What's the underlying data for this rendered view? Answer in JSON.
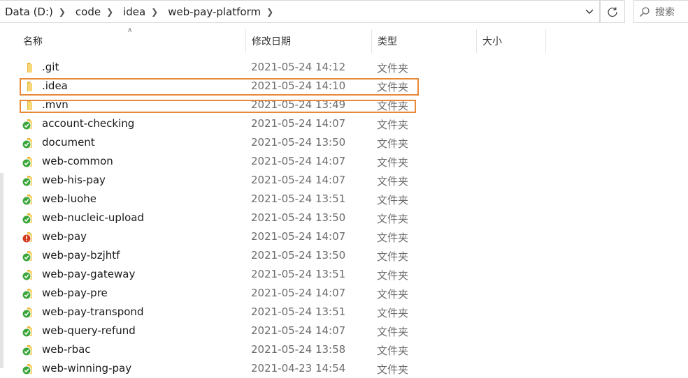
{
  "address_bar": {
    "crumbs": [
      "Data (D:)",
      "code",
      "idea",
      "web-pay-platform"
    ]
  },
  "search": {
    "placeholder": "搜索"
  },
  "columns": {
    "name": "名称",
    "date": "修改日期",
    "type": "类型",
    "size": "大小"
  },
  "files": [
    {
      "name": ".git",
      "date": "2021-05-24 14:12",
      "type": "文件夹",
      "icon": "folder-icon"
    },
    {
      "name": ".idea",
      "date": "2021-05-24 14:10",
      "type": "文件夹",
      "icon": "folder-icon",
      "highlighted": true
    },
    {
      "name": ".mvn",
      "date": "2021-05-24 13:49",
      "type": "文件夹",
      "icon": "folder-icon",
      "highlighted": true
    },
    {
      "name": "account-checking",
      "date": "2021-05-24 14:07",
      "type": "文件夹",
      "icon": "svn-ok-folder-icon"
    },
    {
      "name": "document",
      "date": "2021-05-24 13:50",
      "type": "文件夹",
      "icon": "svn-ok-folder-icon"
    },
    {
      "name": "web-common",
      "date": "2021-05-24 14:07",
      "type": "文件夹",
      "icon": "svn-ok-folder-icon"
    },
    {
      "name": "web-his-pay",
      "date": "2021-05-24 14:07",
      "type": "文件夹",
      "icon": "svn-ok-folder-icon"
    },
    {
      "name": "web-luohe",
      "date": "2021-05-24 13:51",
      "type": "文件夹",
      "icon": "svn-ok-folder-icon"
    },
    {
      "name": "web-nucleic-upload",
      "date": "2021-05-24 13:50",
      "type": "文件夹",
      "icon": "svn-ok-folder-icon"
    },
    {
      "name": "web-pay",
      "date": "2021-05-24 14:07",
      "type": "文件夹",
      "icon": "svn-modified-folder-icon"
    },
    {
      "name": "web-pay-bzjhtf",
      "date": "2021-05-24 13:50",
      "type": "文件夹",
      "icon": "svn-ok-folder-icon"
    },
    {
      "name": "web-pay-gateway",
      "date": "2021-05-24 13:51",
      "type": "文件夹",
      "icon": "svn-ok-folder-icon"
    },
    {
      "name": "web-pay-pre",
      "date": "2021-05-24 14:07",
      "type": "文件夹",
      "icon": "svn-ok-folder-icon"
    },
    {
      "name": "web-pay-transpond",
      "date": "2021-05-24 13:51",
      "type": "文件夹",
      "icon": "svn-ok-folder-icon"
    },
    {
      "name": "web-query-refund",
      "date": "2021-05-24 14:07",
      "type": "文件夹",
      "icon": "svn-ok-folder-icon"
    },
    {
      "name": "web-rbac",
      "date": "2021-05-24 13:58",
      "type": "文件夹",
      "icon": "svn-ok-folder-icon"
    },
    {
      "name": "web-winning-pay",
      "date": "2021-04-23 14:54",
      "type": "文件夹",
      "icon": "svn-ok-folder-icon"
    }
  ],
  "colors": {
    "highlight": "#e8893a",
    "svn_ok": "#3aa63a",
    "svn_modified": "#d43b1e",
    "folder": "#f5c542"
  }
}
